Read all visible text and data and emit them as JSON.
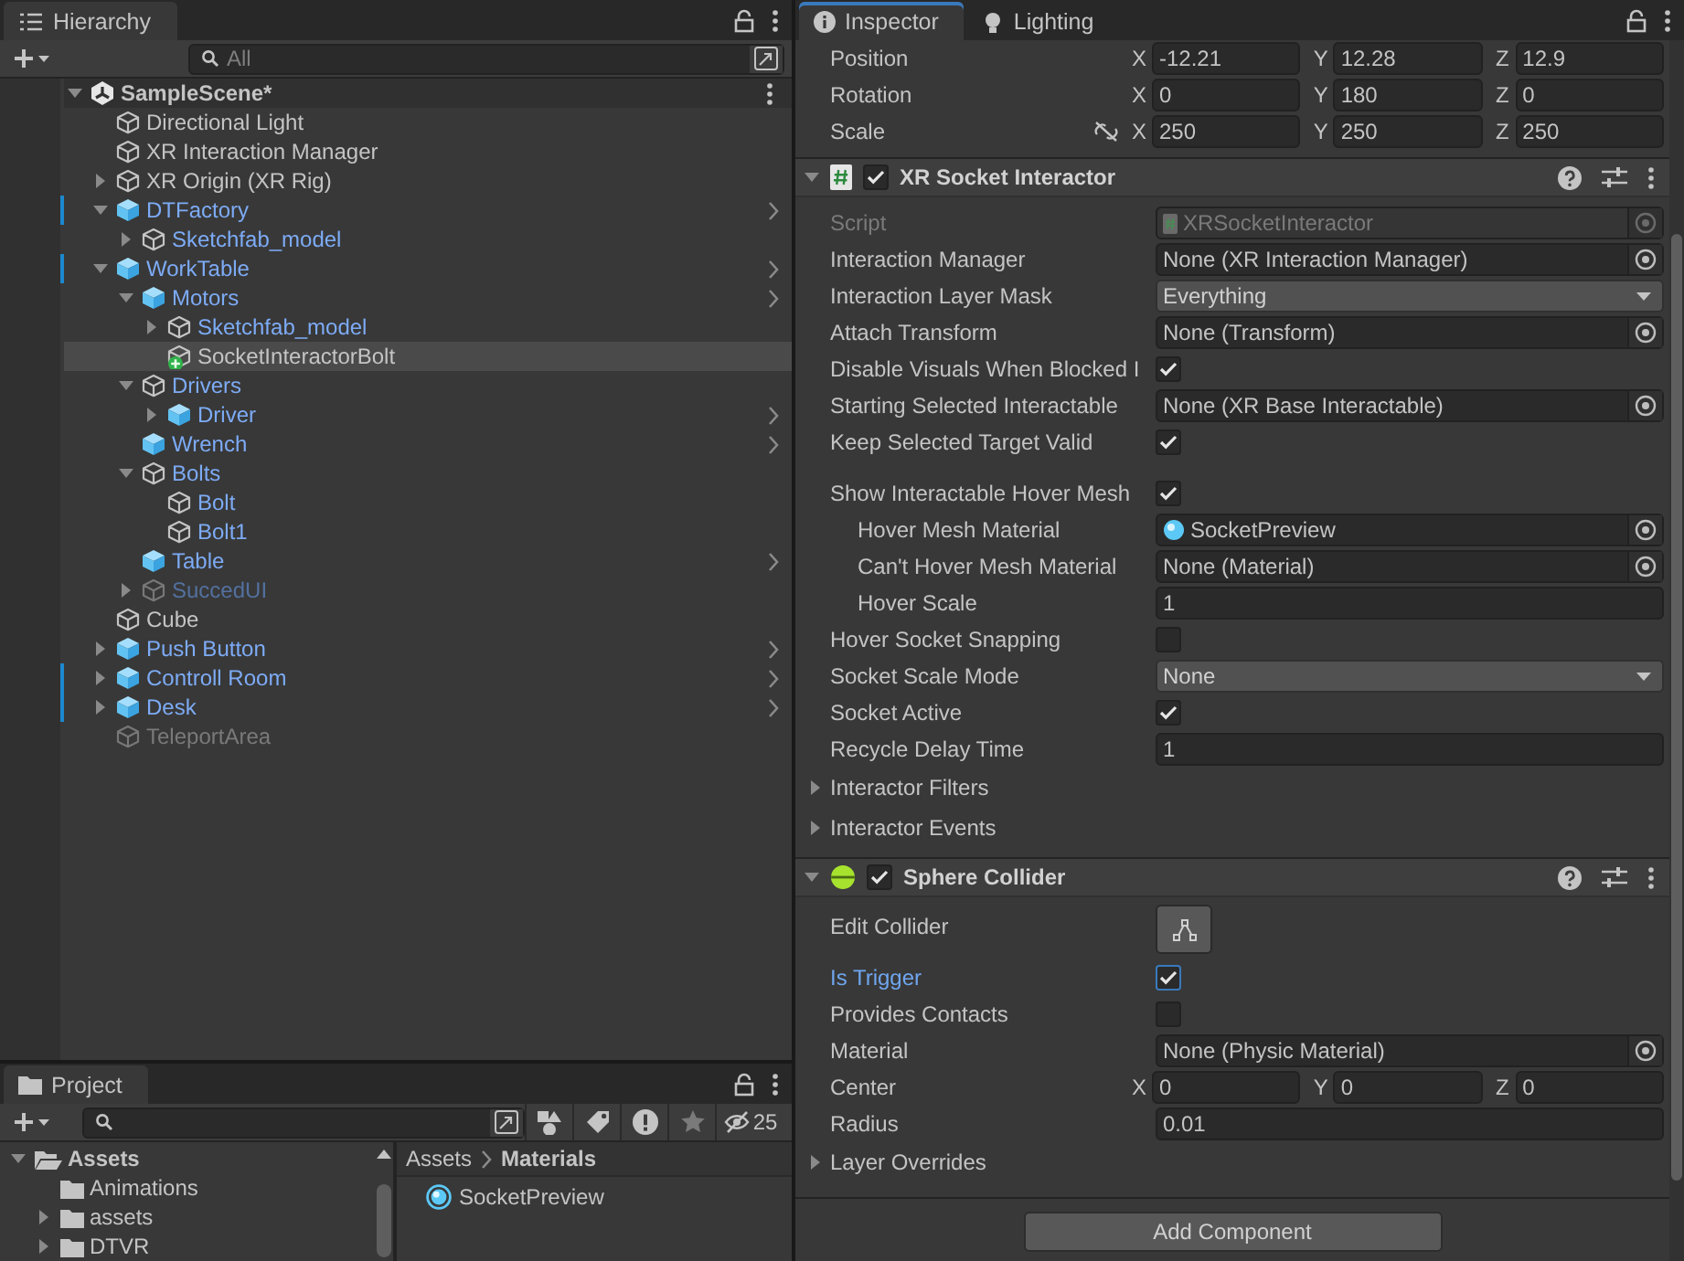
{
  "hierarchy": {
    "tab": {
      "label": "Hierarchy",
      "selected": true
    },
    "search": {
      "placeholder": "All"
    },
    "scene": {
      "label": "SampleScene*",
      "expanded": true,
      "children": [
        {
          "label": "Directional Light",
          "kind": "object",
          "prefab": false,
          "active": true,
          "selected": false,
          "overridden": false,
          "open_button": false
        },
        {
          "label": "XR Interaction Manager",
          "kind": "object",
          "prefab": false,
          "active": true,
          "selected": false,
          "overridden": false,
          "open_button": false
        },
        {
          "label": "XR Origin (XR Rig)",
          "kind": "object",
          "prefab": false,
          "active": true,
          "selected": false,
          "overridden": false,
          "open_button": false,
          "expanded": false
        },
        {
          "label": "DTFactory",
          "kind": "prefab",
          "prefab": true,
          "active": true,
          "selected": false,
          "overridden": true,
          "open_button": true,
          "expanded": true,
          "children": [
            {
              "label": "Sketchfab_model",
              "kind": "object",
              "prefab": true,
              "active": true,
              "selected": false,
              "overridden": false,
              "open_button": false,
              "expanded": false
            }
          ]
        },
        {
          "label": "WorkTable",
          "kind": "prefab",
          "prefab": true,
          "active": true,
          "selected": false,
          "overridden": true,
          "open_button": true,
          "expanded": true,
          "children": [
            {
              "label": "Motors",
              "kind": "prefab",
              "prefab": true,
              "active": true,
              "selected": false,
              "overridden": false,
              "open_button": true,
              "expanded": true,
              "children": [
                {
                  "label": "Sketchfab_model",
                  "kind": "object",
                  "prefab": true,
                  "active": true,
                  "selected": false,
                  "overridden": false,
                  "open_button": false,
                  "expanded": false
                },
                {
                  "label": "SocketInteractorBolt",
                  "kind": "socket",
                  "prefab": false,
                  "active": true,
                  "selected": true,
                  "overridden": false,
                  "open_button": false
                }
              ]
            },
            {
              "label": "Drivers",
              "kind": "object",
              "prefab": true,
              "active": true,
              "selected": false,
              "overridden": false,
              "open_button": false,
              "expanded": true,
              "children": [
                {
                  "label": "Driver",
                  "kind": "prefab",
                  "prefab": true,
                  "active": true,
                  "selected": false,
                  "overridden": false,
                  "open_button": true,
                  "expanded": false
                }
              ]
            },
            {
              "label": "Wrench",
              "kind": "prefab",
              "prefab": true,
              "active": true,
              "selected": false,
              "overridden": false,
              "open_button": true
            },
            {
              "label": "Bolts",
              "kind": "object",
              "prefab": true,
              "active": true,
              "selected": false,
              "overridden": false,
              "open_button": false,
              "expanded": true,
              "children": [
                {
                  "label": "Bolt",
                  "kind": "object",
                  "prefab": true,
                  "active": true,
                  "selected": false,
                  "overridden": false,
                  "open_button": false
                },
                {
                  "label": "Bolt1",
                  "kind": "object",
                  "prefab": true,
                  "active": true,
                  "selected": false,
                  "overridden": false,
                  "open_button": false
                }
              ]
            },
            {
              "label": "Table",
              "kind": "prefab",
              "prefab": true,
              "active": true,
              "selected": false,
              "overridden": false,
              "open_button": true
            },
            {
              "label": "SuccedUI",
              "kind": "object",
              "prefab": true,
              "active": false,
              "selected": false,
              "overridden": false,
              "open_button": false,
              "expanded": false
            }
          ]
        },
        {
          "label": "Cube",
          "kind": "object",
          "prefab": false,
          "active": true,
          "selected": false,
          "overridden": false,
          "open_button": false
        },
        {
          "label": "Push Button",
          "kind": "prefab",
          "prefab": true,
          "active": true,
          "selected": false,
          "overridden": false,
          "open_button": true,
          "expanded": false
        },
        {
          "label": "Controll Room",
          "kind": "prefab",
          "prefab": true,
          "active": true,
          "selected": false,
          "overridden": true,
          "open_button": true,
          "expanded": false
        },
        {
          "label": "Desk",
          "kind": "prefab",
          "prefab": true,
          "active": true,
          "selected": false,
          "overridden": true,
          "open_button": true,
          "expanded": false
        },
        {
          "label": "TeleportArea",
          "kind": "object",
          "prefab": false,
          "active": false,
          "selected": false,
          "overridden": false,
          "open_button": false
        }
      ]
    }
  },
  "inspector": {
    "tabs": [
      {
        "label": "Inspector",
        "kind": "info",
        "selected": true
      },
      {
        "label": "Lighting",
        "kind": "lighting",
        "selected": false
      }
    ],
    "transform": [
      {
        "label": "Position",
        "values": [
          {
            "axis": "X",
            "value": "-12.21"
          },
          {
            "axis": "Y",
            "value": "12.28"
          },
          {
            "axis": "Z",
            "value": "12.9"
          }
        ]
      },
      {
        "label": "Rotation",
        "values": [
          {
            "axis": "X",
            "value": "0"
          },
          {
            "axis": "Y",
            "value": "180"
          },
          {
            "axis": "Z",
            "value": "0"
          }
        ]
      },
      {
        "label": "Scale",
        "proportional": false,
        "values": [
          {
            "axis": "X",
            "value": "250"
          },
          {
            "axis": "Y",
            "value": "250"
          },
          {
            "axis": "Z",
            "value": "250"
          }
        ]
      }
    ],
    "components": [
      {
        "title": "XR Socket Interactor",
        "kind": "script",
        "enabled": true,
        "expanded": true,
        "rows": [
          {
            "kind": "script",
            "label": "Script",
            "value": "XRSocketInteractor"
          },
          {
            "kind": "object",
            "label": "Interaction Manager",
            "value": "None (XR Interaction Manager)",
            "assigned": false
          },
          {
            "kind": "enum",
            "label": "Interaction Layer Mask",
            "value": "Everything"
          },
          {
            "kind": "object",
            "label": "Attach Transform",
            "value": "None (Transform)",
            "assigned": false
          },
          {
            "kind": "toggle",
            "label": "Disable Visuals When Blocked I",
            "checked": true,
            "focused": false
          },
          {
            "kind": "object",
            "label": "Starting Selected Interactable",
            "value": "None (XR Base Interactable)",
            "assigned": false
          },
          {
            "kind": "toggle",
            "label": "Keep Selected Target Valid",
            "checked": true,
            "focused": false
          },
          {
            "kind": "toggle",
            "label": "Show Interactable Hover Mesh",
            "checked": true,
            "focused": false,
            "children": [
              {
                "kind": "object",
                "label": "Hover Mesh Material",
                "value": "SocketPreview",
                "assigned": true
              },
              {
                "kind": "object",
                "label": "Can't Hover Mesh Material",
                "value": "None (Material)",
                "assigned": false
              },
              {
                "kind": "number",
                "label": "Hover Scale",
                "value": "1"
              }
            ]
          },
          {
            "kind": "toggle",
            "label": "Hover Socket Snapping",
            "checked": false,
            "focused": false
          },
          {
            "kind": "enum",
            "label": "Socket Scale Mode",
            "value": "None"
          },
          {
            "kind": "toggle",
            "label": "Socket Active",
            "checked": true,
            "focused": false
          },
          {
            "kind": "number",
            "label": "Recycle Delay Time",
            "value": "1"
          },
          {
            "kind": "foldout",
            "label": "Interactor Filters",
            "expanded": false
          },
          {
            "kind": "foldout",
            "label": "Interactor Events",
            "expanded": false
          }
        ]
      },
      {
        "title": "Sphere Collider",
        "kind": "collider",
        "enabled": true,
        "expanded": true,
        "rows": [
          {
            "kind": "edit_button",
            "label": "Edit Collider"
          },
          {
            "kind": "toggle",
            "label": "Is Trigger",
            "checked": true,
            "focused": true
          },
          {
            "kind": "toggle",
            "label": "Provides Contacts",
            "checked": false,
            "focused": false
          },
          {
            "kind": "object",
            "label": "Material",
            "value": "None (Physic Material)",
            "assigned": false
          },
          {
            "kind": "vector3",
            "label": "Center",
            "values": [
              {
                "axis": "X",
                "value": "0"
              },
              {
                "axis": "Y",
                "value": "0"
              },
              {
                "axis": "Z",
                "value": "0"
              }
            ]
          },
          {
            "kind": "number",
            "label": "Radius",
            "value": "0.01"
          },
          {
            "kind": "foldout",
            "label": "Layer Overrides",
            "expanded": false
          }
        ]
      }
    ],
    "add_component": "Add Component"
  },
  "project": {
    "tab": {
      "label": "Project",
      "selected": true
    },
    "hidden_count": "25",
    "tree": [
      {
        "label": "Assets",
        "expanded": true,
        "children": [
          {
            "label": "Animations"
          },
          {
            "label": "assets",
            "expanded": false
          },
          {
            "label": "DTVR",
            "expanded": false
          }
        ]
      }
    ],
    "breadcrumb": [
      "Assets",
      "Materials"
    ],
    "items": [
      {
        "label": "SocketPreview"
      }
    ]
  }
}
